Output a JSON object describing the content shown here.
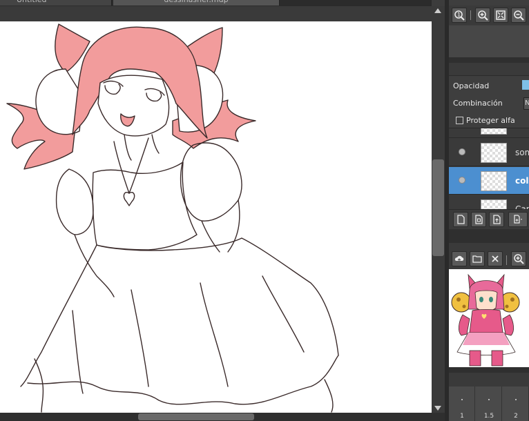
{
  "doc_tabs": [
    {
      "label": "Untitled"
    },
    {
      "label": "dessinasher.mdp"
    }
  ],
  "layer_props": {
    "opacity_label": "Opacidad",
    "blend_label": "Combinación",
    "blend_value": "N",
    "protect_alpha_label": "Proteger alfa",
    "protect_alpha_checked": false
  },
  "layers": [
    {
      "name": "som",
      "visible": true,
      "selected": false
    },
    {
      "name": "color",
      "visible": true,
      "selected": true
    },
    {
      "name": "Capa",
      "visible": false,
      "selected": false
    }
  ],
  "brush_sizes": [
    {
      "label": "1"
    },
    {
      "label": "1.5"
    },
    {
      "label": "2"
    }
  ],
  "colors": {
    "hair": "#f29c9c",
    "line": "#3a2a2a",
    "selected_layer": "#4c8fd0"
  }
}
